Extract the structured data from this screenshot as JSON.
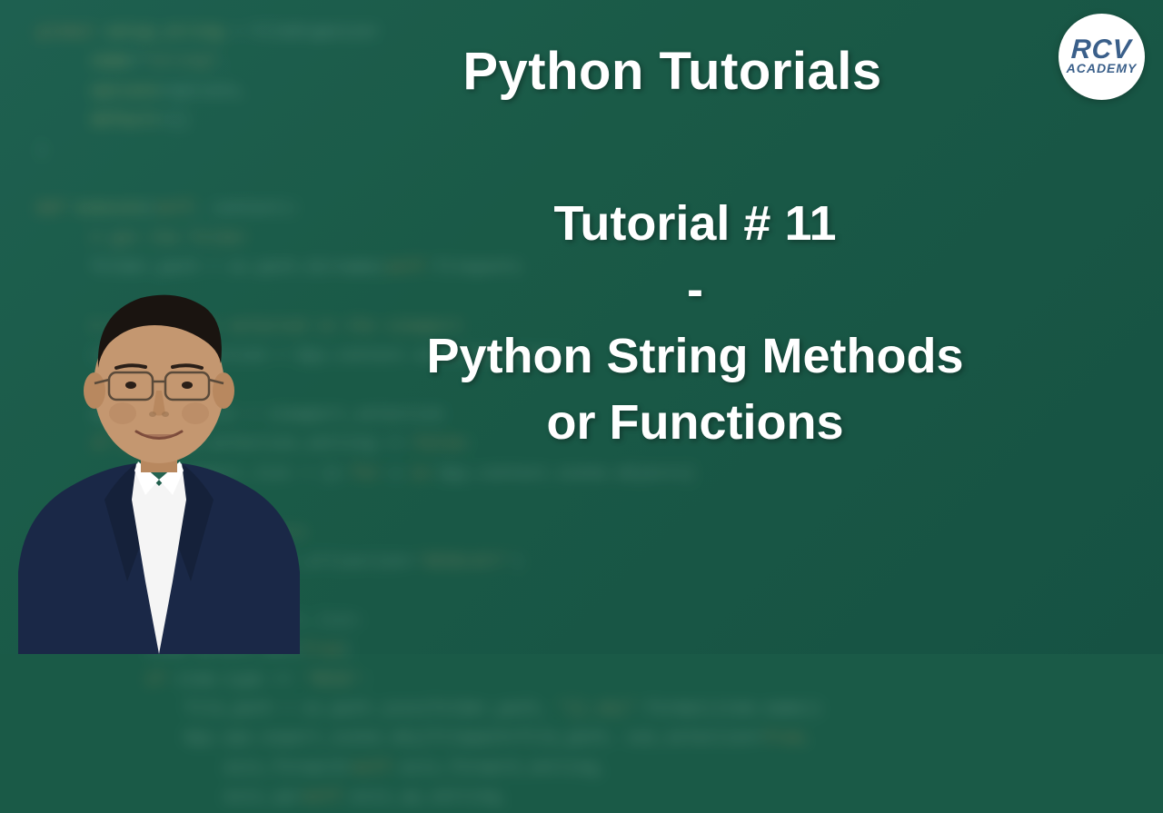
{
  "logo": {
    "main": "RCV",
    "sub": "ACADEMY"
  },
  "title": {
    "main": "Python Tutorials"
  },
  "subtitle": {
    "line1": "Tutorial # 11",
    "line2": "-",
    "line3": "Python String Methods",
    "line4": "or Functions"
  },
  "background": {
    "color_primary": "#1a5a47",
    "color_secondary": "#165243"
  }
}
